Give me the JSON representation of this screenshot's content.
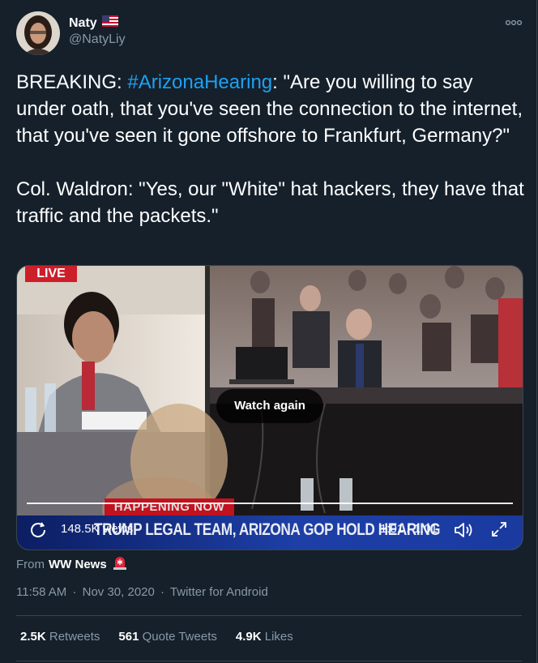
{
  "author": {
    "display_name": "Naty",
    "flag_icon": "us-flag-icon",
    "handle": "@NatyLiy"
  },
  "tweet": {
    "prefix": "BREAKING: ",
    "hashtag": "#ArizonaHearing",
    "line1_rest": ": \"Are you willing to say under oath, that you've seen the connection to the internet, that you've seen it gone offshore to Frankfurt, Germany?\"",
    "paragraph2": "Col. Waldron: \"Yes, our \"White\" hat hackers, they have that traffic and the packets.\""
  },
  "video": {
    "live_label": "LIVE",
    "watch_again_label": "Watch again",
    "happening_now": "HAPPENING NOW",
    "chyron": "TRUMP LEGAL TEAM, ARIZONA GOP HOLD HEARING ON ELECTION FRAUD",
    "views": "148.5K views",
    "time": "1:01 / 1:01",
    "progress": 1.0
  },
  "source": {
    "from_label": "From",
    "name": "WW News",
    "badge_icon": "siren-icon"
  },
  "meta": {
    "time": "11:58 AM",
    "date": "Nov 30, 2020",
    "client": "Twitter for Android",
    "separator": "·"
  },
  "stats": {
    "retweets_count": "2.5K",
    "retweets_label": "Retweets",
    "quotes_count": "561",
    "quotes_label": "Quote Tweets",
    "likes_count": "4.9K",
    "likes_label": "Likes"
  },
  "colors": {
    "background": "#15202b",
    "link": "#1da1f2",
    "muted": "#8899a6",
    "border": "#38444d"
  }
}
